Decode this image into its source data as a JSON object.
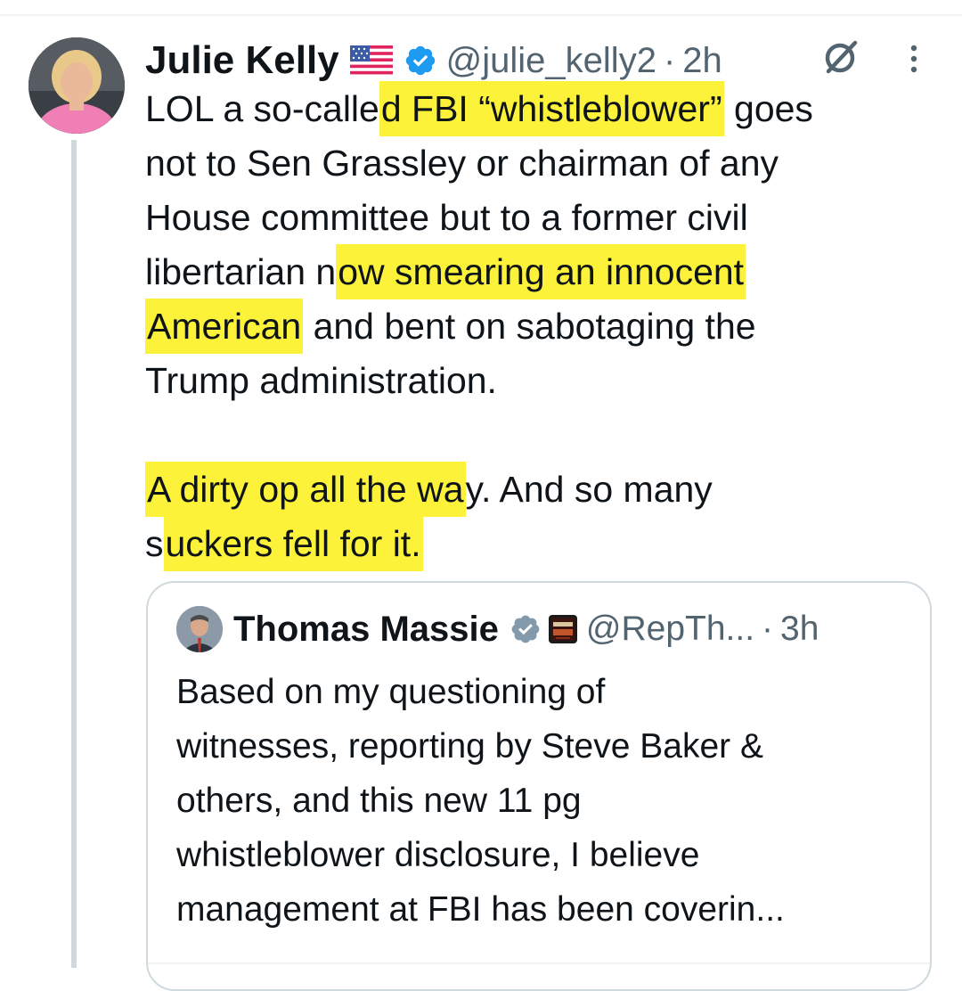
{
  "tweet": {
    "author": {
      "display_name": "Julie Kelly",
      "handle": "@julie_kelly2",
      "flag_icon": "us-flag-icon",
      "verified": true
    },
    "separator": "·",
    "time": "2h",
    "text_lines": [
      {
        "pre": "LOL a so-calle",
        "hl": "d FBI “whistleblower”",
        "post": " goes"
      },
      {
        "pre": "not to Sen Grassley or chairman of any",
        "hl": "",
        "post": ""
      },
      {
        "pre": "House committee but to a former civil",
        "hl": "",
        "post": ""
      },
      {
        "pre": "libertarian n",
        "hl": "ow smearing an innocent",
        "post": ""
      },
      {
        "pre": "",
        "hl": "American",
        "post": " and bent on sabotaging the"
      },
      {
        "pre": "Trump administration.",
        "hl": "",
        "post": ""
      },
      {
        "pre": "",
        "hl": "",
        "post": ""
      },
      {
        "pre": "",
        "hl": "A dirty op all the wa",
        "post": "y.  And so many"
      },
      {
        "pre": "s",
        "hl": "uckers fell for it.",
        "post": ""
      }
    ]
  },
  "quoted": {
    "author": {
      "display_name": "Thomas Massie",
      "handle": "@RepTh...",
      "verified": true,
      "badge_icon": "affiliate-badge-icon"
    },
    "separator": "·",
    "time": "3h",
    "text_lines": [
      "Based on my questioning of",
      "witnesses, reporting by Steve Baker &",
      "others, and this new 11 pg",
      "whistleblower disclosure, I believe",
      "management at FBI has been coverin..."
    ]
  },
  "icons": {
    "grok": "grok-icon",
    "more": "more-options-icon",
    "verified": "verified-badge-icon"
  },
  "colors": {
    "text": "#0f1419",
    "secondary_text": "#536471",
    "verified_blue": "#1d9bf0",
    "verified_gray": "#829aab",
    "highlight": "#fbf239",
    "border": "#cfd9de"
  }
}
